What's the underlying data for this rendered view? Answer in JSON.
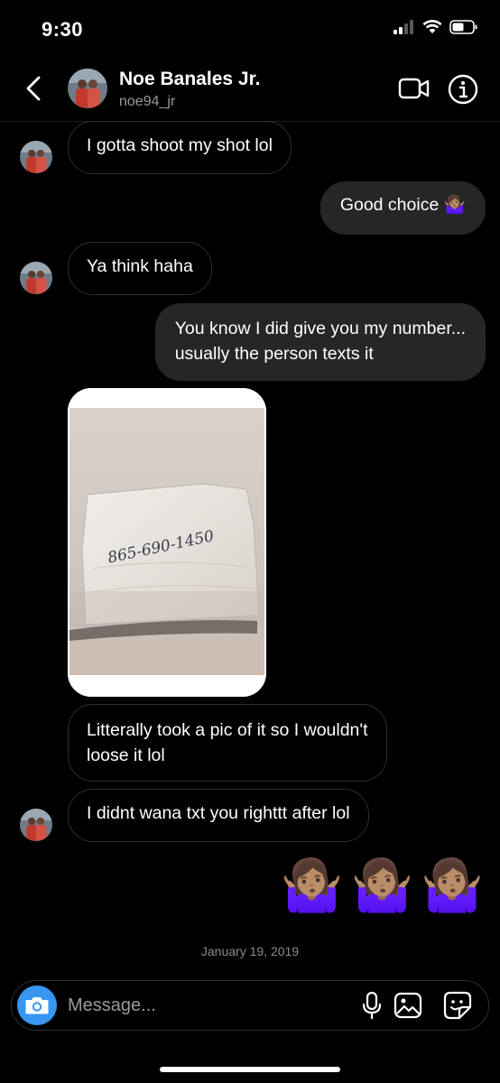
{
  "status_bar": {
    "time": "9:30"
  },
  "header": {
    "name": "Noe Banales Jr.",
    "username": "noe94_jr"
  },
  "messages": [
    {
      "direction": "in",
      "text": "I gotta shoot my shot lol",
      "avatar": true
    },
    {
      "direction": "out",
      "text": "Good choice 🤷🏽‍♀️"
    },
    {
      "direction": "in",
      "text": "Ya think haha",
      "avatar": true
    },
    {
      "direction": "out",
      "lines": [
        "You know I did give you my number...",
        "usually the person texts it"
      ]
    },
    {
      "direction": "in",
      "type": "photo",
      "photo_text": "865-690-1450"
    },
    {
      "direction": "in",
      "lines": [
        "Litterally took a pic of it so I wouldn't",
        "loose it lol"
      ]
    },
    {
      "direction": "in",
      "text": "I didnt wana txt you righttt after lol",
      "avatar": true
    },
    {
      "direction": "out",
      "type": "emoji",
      "emoji": [
        "🤷🏽‍♀️",
        "🤷🏽‍♀️",
        "🤷🏽‍♀️"
      ]
    }
  ],
  "date_stamp": "January 19, 2019",
  "composer": {
    "placeholder": "Message..."
  },
  "icons": {
    "back": "chevron-left-icon",
    "video": "video-camera-icon",
    "info": "info-icon",
    "camera": "camera-icon",
    "mic": "microphone-icon",
    "gallery": "gallery-icon",
    "sticker": "sticker-icon"
  },
  "colors": {
    "background": "#000000",
    "outgoing_bubble": "#262626",
    "incoming_border": "#2f2f2f",
    "accent": "#3797f0",
    "secondary_text": "#9a9a9a"
  }
}
